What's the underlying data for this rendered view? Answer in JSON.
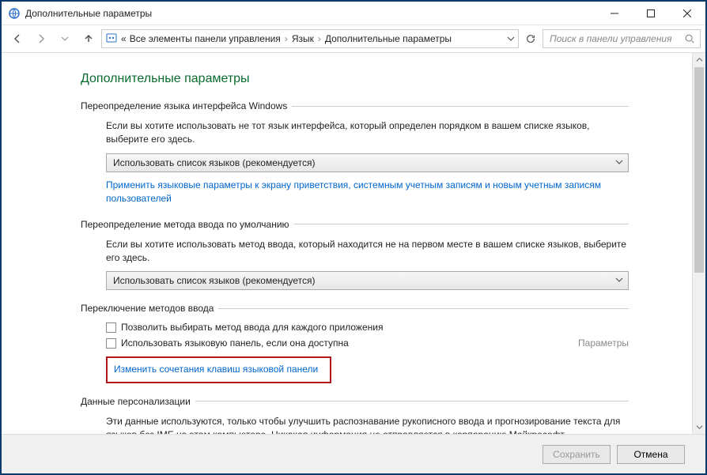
{
  "window": {
    "title": "Дополнительные параметры"
  },
  "breadcrumb": {
    "root_prefix": "«",
    "item1": "Все элементы панели управления",
    "item2": "Язык",
    "item3": "Дополнительные параметры"
  },
  "search": {
    "placeholder": "Поиск в панели управления"
  },
  "page": {
    "title": "Дополнительные параметры"
  },
  "group_ui_lang": {
    "header": "Переопределение языка интерфейса Windows",
    "help": "Если вы хотите использовать не тот язык интерфейса, который определен порядком в вашем списке языков, выберите его здесь.",
    "dropdown": "Использовать список языков (рекомендуется)",
    "link": "Применить языковые параметры к экрану приветствия, системным учетным записям и новым учетным записям пользователей"
  },
  "group_input_default": {
    "header": "Переопределение метода ввода по умолчанию",
    "help": "Если вы хотите использовать метод ввода, который находится не на первом месте в вашем списке языков, выберите его здесь.",
    "dropdown": "Использовать список языков (рекомендуется)"
  },
  "group_switching": {
    "header": "Переключение методов ввода",
    "cb1": "Позволить выбирать метод ввода для каждого приложения",
    "cb2": "Использовать языковую панель, если она доступна",
    "side": "Параметры",
    "link": "Изменить сочетания клавиш языковой панели"
  },
  "group_personalization": {
    "header": "Данные персонализации",
    "text": "Эти данные используются, только чтобы улучшить распознавание рукописного ввода и прогнозирование текста для языков без IME на этом компьютере. Никакая информация не отправляется в корпорацию Майкрософт."
  },
  "footer": {
    "save": "Сохранить",
    "cancel": "Отмена"
  }
}
